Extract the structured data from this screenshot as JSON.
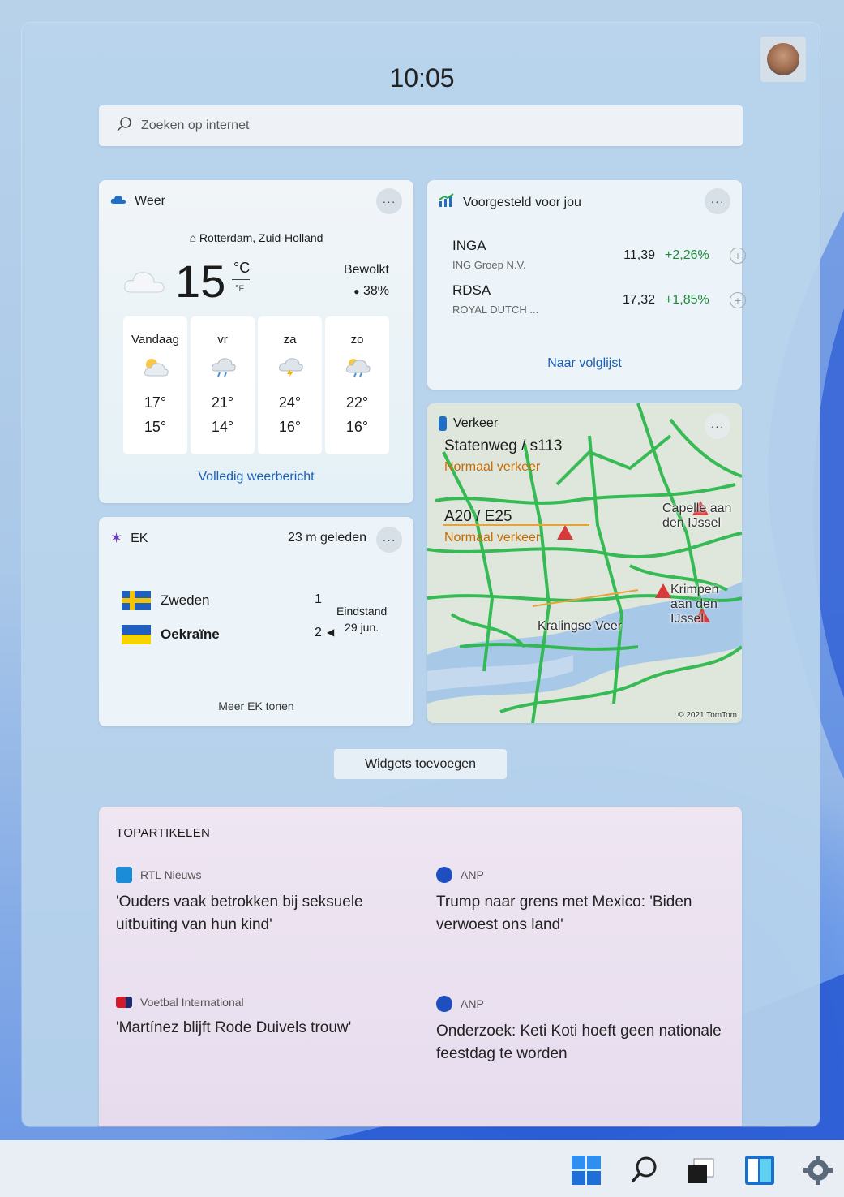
{
  "clock": "10:05",
  "search": {
    "placeholder": "Zoeken op internet"
  },
  "weather": {
    "title": "Weer",
    "location": "Rotterdam, Zuid-Holland",
    "temp": "15",
    "unit_c": "°C",
    "unit_f": "°F",
    "condition": "Bewolkt",
    "precip": "38%",
    "days": [
      {
        "label": "Vandaag",
        "hi": "17°",
        "lo": "15°"
      },
      {
        "label": "vr",
        "hi": "21°",
        "lo": "14°"
      },
      {
        "label": "za",
        "hi": "24°",
        "lo": "16°"
      },
      {
        "label": "zo",
        "hi": "22°",
        "lo": "16°"
      }
    ],
    "link": "Volledig weerbericht"
  },
  "stocks": {
    "title": "Voorgesteld voor jou",
    "items": [
      {
        "symbol": "INGA",
        "name": "ING Groep N.V.",
        "price": "11,39",
        "change": "+2,26%"
      },
      {
        "symbol": "RDSA",
        "name": "ROYAL DUTCH ...",
        "price": "17,32",
        "change": "+1,85%"
      }
    ],
    "link": "Naar volglijst"
  },
  "ek": {
    "title": "EK",
    "ago": "23 m geleden",
    "teams": [
      {
        "name": "Zweden",
        "score": "1"
      },
      {
        "name": "Oekraïne",
        "score": "2"
      }
    ],
    "result_label": "Eindstand",
    "result_date": "29 jun.",
    "more": "Meer EK tonen"
  },
  "traffic": {
    "title": "Verkeer",
    "roads": [
      {
        "name": "Statenweg / s113",
        "status": "Normaal verkeer"
      },
      {
        "name": "A20 / E25",
        "status": "Normaal verkeer"
      }
    ],
    "map_labels": {
      "capelle": "Capelle aan den IJssel",
      "krimpen": "Krimpen aan den IJssel",
      "kralingse": "Kralingse Veer"
    },
    "copyright": "© 2021 TomTom"
  },
  "add_widgets": "Widgets toevoegen",
  "news": {
    "section": "TOPARTIKELEN",
    "articles": [
      {
        "source": "RTL Nieuws",
        "title": "'Ouders vaak betrokken bij seksuele uitbuiting van hun kind'"
      },
      {
        "source": "ANP",
        "title": "Trump naar grens met Mexico: 'Biden verwoest ons land'"
      },
      {
        "source": "Voetbal International",
        "title": "'Martínez blijft Rode Duivels trouw'"
      },
      {
        "source": "ANP",
        "title": "Onderzoek: Keti Koti hoeft geen nationale feestdag te worden"
      }
    ]
  },
  "colors": {
    "accent": "#1a5fb4",
    "positive": "#1e8a3a",
    "traffic_warn": "#c76a00"
  }
}
